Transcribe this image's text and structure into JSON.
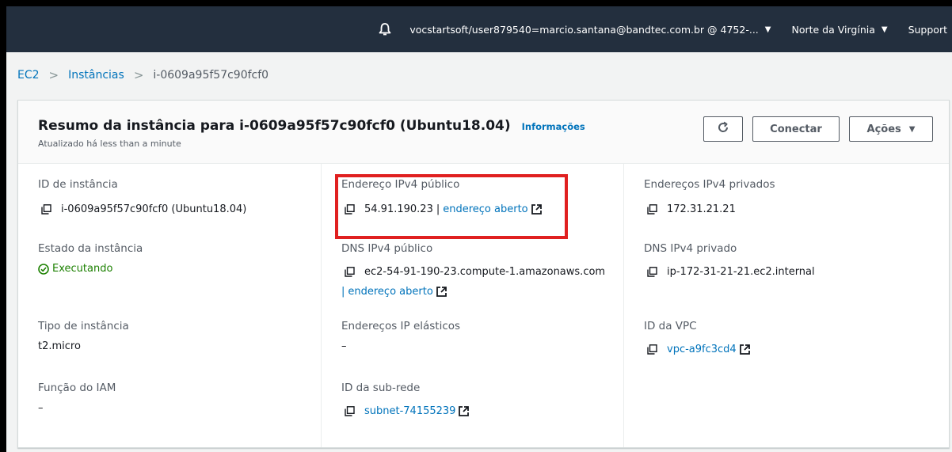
{
  "topnav": {
    "account": "vocstartsoft/user879540=marcio.santana@bandtec.com.br @ 4752-...",
    "region": "Norte da Virgínia",
    "support": "Support"
  },
  "breadcrumb": {
    "root": "EC2",
    "section": "Instâncias",
    "current": "i-0609a95f57c90fcf0"
  },
  "summary": {
    "title": "Resumo da instância para i-0609a95f57c90fcf0 (Ubuntu18.04)",
    "info_link": "Informações",
    "updated": "Atualizado há less than a minute",
    "connect_label": "Conectar",
    "actions_label": "Ações"
  },
  "details": {
    "instance_id": {
      "label": "ID de instância",
      "value": "i-0609a95f57c90fcf0 (Ubuntu18.04)"
    },
    "instance_state": {
      "label": "Estado da instância",
      "value": "Executando"
    },
    "instance_type": {
      "label": "Tipo de instância",
      "value": "t2.micro"
    },
    "iam_role": {
      "label": "Função do IAM",
      "value": "–"
    },
    "public_ipv4": {
      "label": "Endereço IPv4 público",
      "value": "54.91.190.23",
      "sep": "|",
      "link": "endereço aberto"
    },
    "public_dns": {
      "label": "DNS IPv4 público",
      "value": "ec2-54-91-190-23.compute-1.amazonaws.com",
      "sep": "|",
      "link": "endereço aberto"
    },
    "elastic_ip": {
      "label": "Endereços IP elásticos",
      "value": "–"
    },
    "subnet_id": {
      "label": "ID da sub-rede",
      "value": "subnet-74155239"
    },
    "private_ipv4": {
      "label": "Endereços IPv4 privados",
      "value": "172.31.21.21"
    },
    "private_dns": {
      "label": "DNS IPv4 privado",
      "value": "ip-172-31-21-21.ec2.internal"
    },
    "vpc_id": {
      "label": "ID da VPC",
      "value": "vpc-a9fc3cd4"
    }
  },
  "colors": {
    "nav_bg": "#232f3e",
    "link": "#0073bb",
    "running": "#1d8102",
    "highlight": "#e02020"
  },
  "icons": [
    "bell-icon",
    "caret-down-icon",
    "chevron-right-icon",
    "refresh-icon",
    "copy-icon",
    "external-link-icon",
    "status-ok-icon"
  ]
}
